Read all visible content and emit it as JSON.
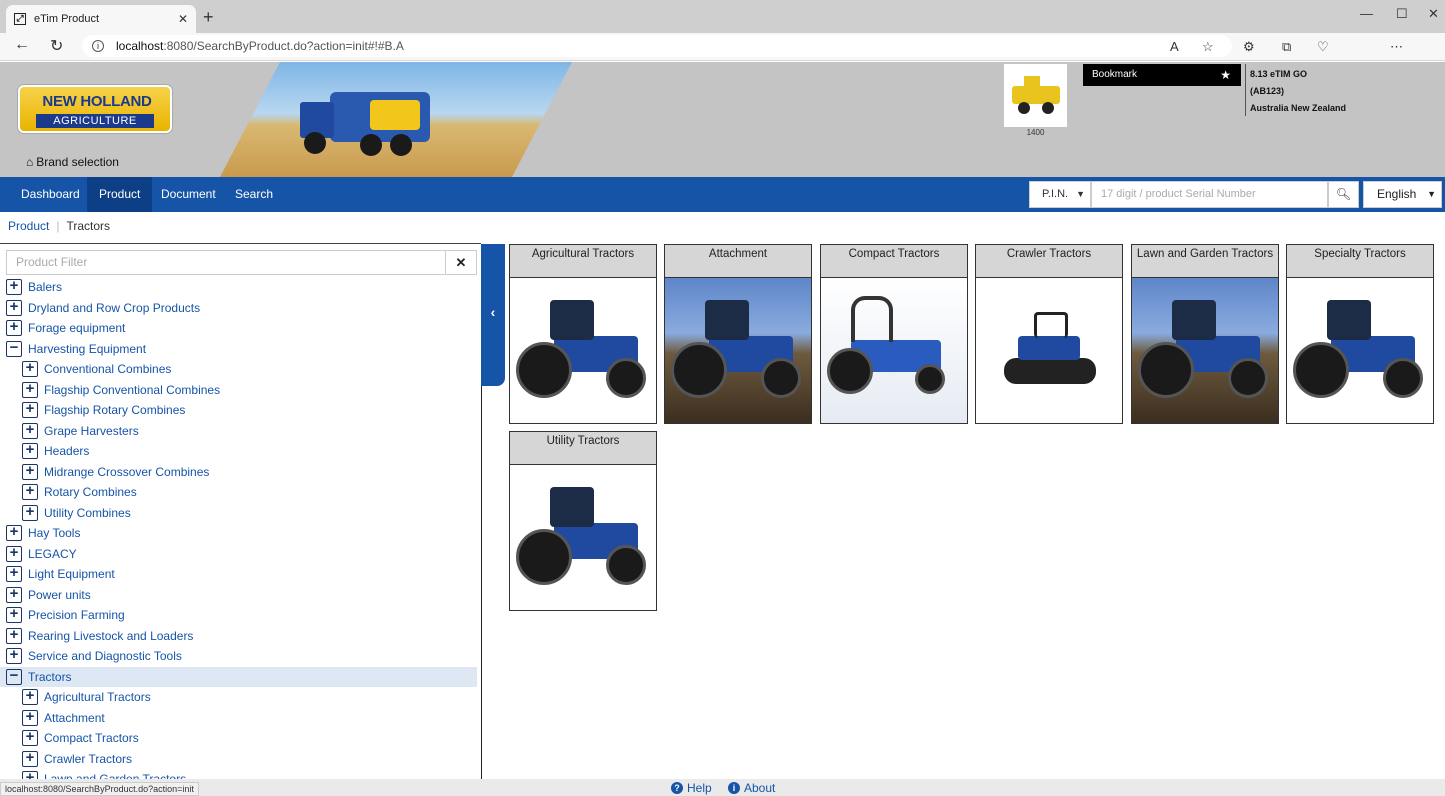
{
  "browser": {
    "tab_title": "eTim Product",
    "url_host": "localhost",
    "url_path": ":8080/SearchByProduct.do?action=init#!#B.A",
    "status_url": "localhost:8080/SearchByProduct.do?action=init"
  },
  "header": {
    "logo_line1": "NEW HOLLAND",
    "logo_line2": "AGRICULTURE",
    "brand_selection": "Brand selection",
    "thumb_caption": "1400",
    "bookmark_label": "Bookmark",
    "version": "8.13 eTIM GO",
    "dealer_code": "(AB123)",
    "region": "Australia New Zealand"
  },
  "nav": {
    "items": [
      {
        "label": "Dashboard"
      },
      {
        "label": "Product"
      },
      {
        "label": "Document"
      },
      {
        "label": "Search"
      }
    ],
    "active": "Product",
    "search_type": "P.I.N.",
    "serial_placeholder": "17 digit / product Serial Number",
    "language": "English"
  },
  "breadcrumb": [
    "Product",
    "Tractors"
  ],
  "left": {
    "filter_placeholder": "Product Filter",
    "tree": [
      {
        "label": "Balers",
        "level": 0,
        "expanded": false
      },
      {
        "label": "Dryland and Row Crop Products",
        "level": 0,
        "expanded": false
      },
      {
        "label": "Forage equipment",
        "level": 0,
        "expanded": false
      },
      {
        "label": "Harvesting Equipment",
        "level": 0,
        "expanded": true
      },
      {
        "label": "Conventional Combines",
        "level": 1,
        "expanded": false
      },
      {
        "label": "Flagship Conventional Combines",
        "level": 1,
        "expanded": false
      },
      {
        "label": "Flagship Rotary Combines",
        "level": 1,
        "expanded": false
      },
      {
        "label": "Grape Harvesters",
        "level": 1,
        "expanded": false
      },
      {
        "label": "Headers",
        "level": 1,
        "expanded": false
      },
      {
        "label": "Midrange Crossover Combines",
        "level": 1,
        "expanded": false
      },
      {
        "label": "Rotary Combines",
        "level": 1,
        "expanded": false
      },
      {
        "label": "Utility Combines",
        "level": 1,
        "expanded": false
      },
      {
        "label": "Hay Tools",
        "level": 0,
        "expanded": false
      },
      {
        "label": "LEGACY",
        "level": 0,
        "expanded": false
      },
      {
        "label": "Light Equipment",
        "level": 0,
        "expanded": false
      },
      {
        "label": "Power units",
        "level": 0,
        "expanded": false
      },
      {
        "label": "Precision Farming",
        "level": 0,
        "expanded": false
      },
      {
        "label": "Rearing Livestock and Loaders",
        "level": 0,
        "expanded": false
      },
      {
        "label": "Service and Diagnostic Tools",
        "level": 0,
        "expanded": false
      },
      {
        "label": "Tractors",
        "level": 0,
        "expanded": true,
        "selected": true
      },
      {
        "label": "Agricultural Tractors",
        "level": 1,
        "expanded": false
      },
      {
        "label": "Attachment",
        "level": 1,
        "expanded": false
      },
      {
        "label": "Compact Tractors",
        "level": 1,
        "expanded": false
      },
      {
        "label": "Crawler Tractors",
        "level": 1,
        "expanded": false
      },
      {
        "label": "Lawn and Garden Tractors",
        "level": 1,
        "expanded": false
      }
    ]
  },
  "cards": [
    {
      "title": "Agricultural Tractors",
      "bg": "white"
    },
    {
      "title": "Attachment",
      "bg": "field"
    },
    {
      "title": "Compact Tractors",
      "bg": "light"
    },
    {
      "title": "Crawler Tractors",
      "bg": "white"
    },
    {
      "title": "Lawn and Garden Tractors",
      "bg": "field"
    },
    {
      "title": "Specialty Tractors",
      "bg": "white"
    },
    {
      "title": "Utility Tractors",
      "bg": "white"
    }
  ],
  "footer": {
    "help": "Help",
    "about": "About"
  },
  "colors": {
    "nav_blue": "#1654a8",
    "nav_active": "#0d3f86",
    "header_gray": "#c4c4c4",
    "tractor_blue": "#1f4aa0"
  }
}
